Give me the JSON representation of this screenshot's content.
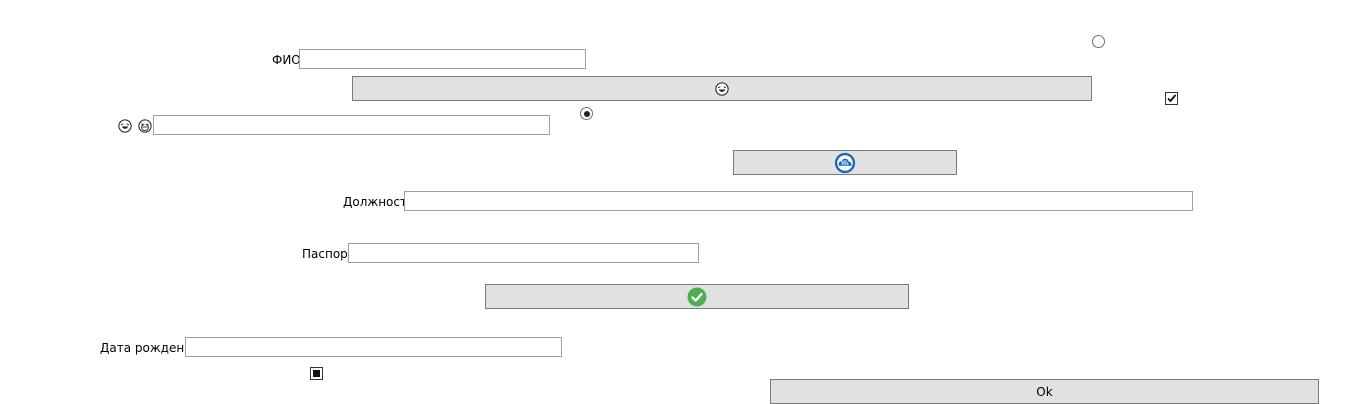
{
  "form": {
    "fio_label": "ФИО",
    "fio_value": "",
    "position_label": "Должность",
    "position_value": "",
    "passport_label": "Паспорт",
    "passport_value": "",
    "birthdate_label": "Дата рождения",
    "birthdate_value": "",
    "emoji_field_value": ""
  },
  "controls": {
    "radio_top_checked": false,
    "radio_mid_checked": true,
    "checkbox_right_checked": true,
    "checkbox_bottom_state": "indeterminate"
  },
  "buttons": {
    "laugh_button_icon": "laughing-face-icon",
    "cloud_button_icon": "cloud-app-icon",
    "check_button_icon": "green-check-circle-icon",
    "ok_label": "Ok"
  },
  "icons": {
    "emoji_1": "laughing-face-icon",
    "emoji_2": "grinning-face-icon"
  },
  "colors": {
    "button_face": "#e1e1e1",
    "cloud_blue": "#1565c0",
    "check_green": "#4caf50"
  }
}
